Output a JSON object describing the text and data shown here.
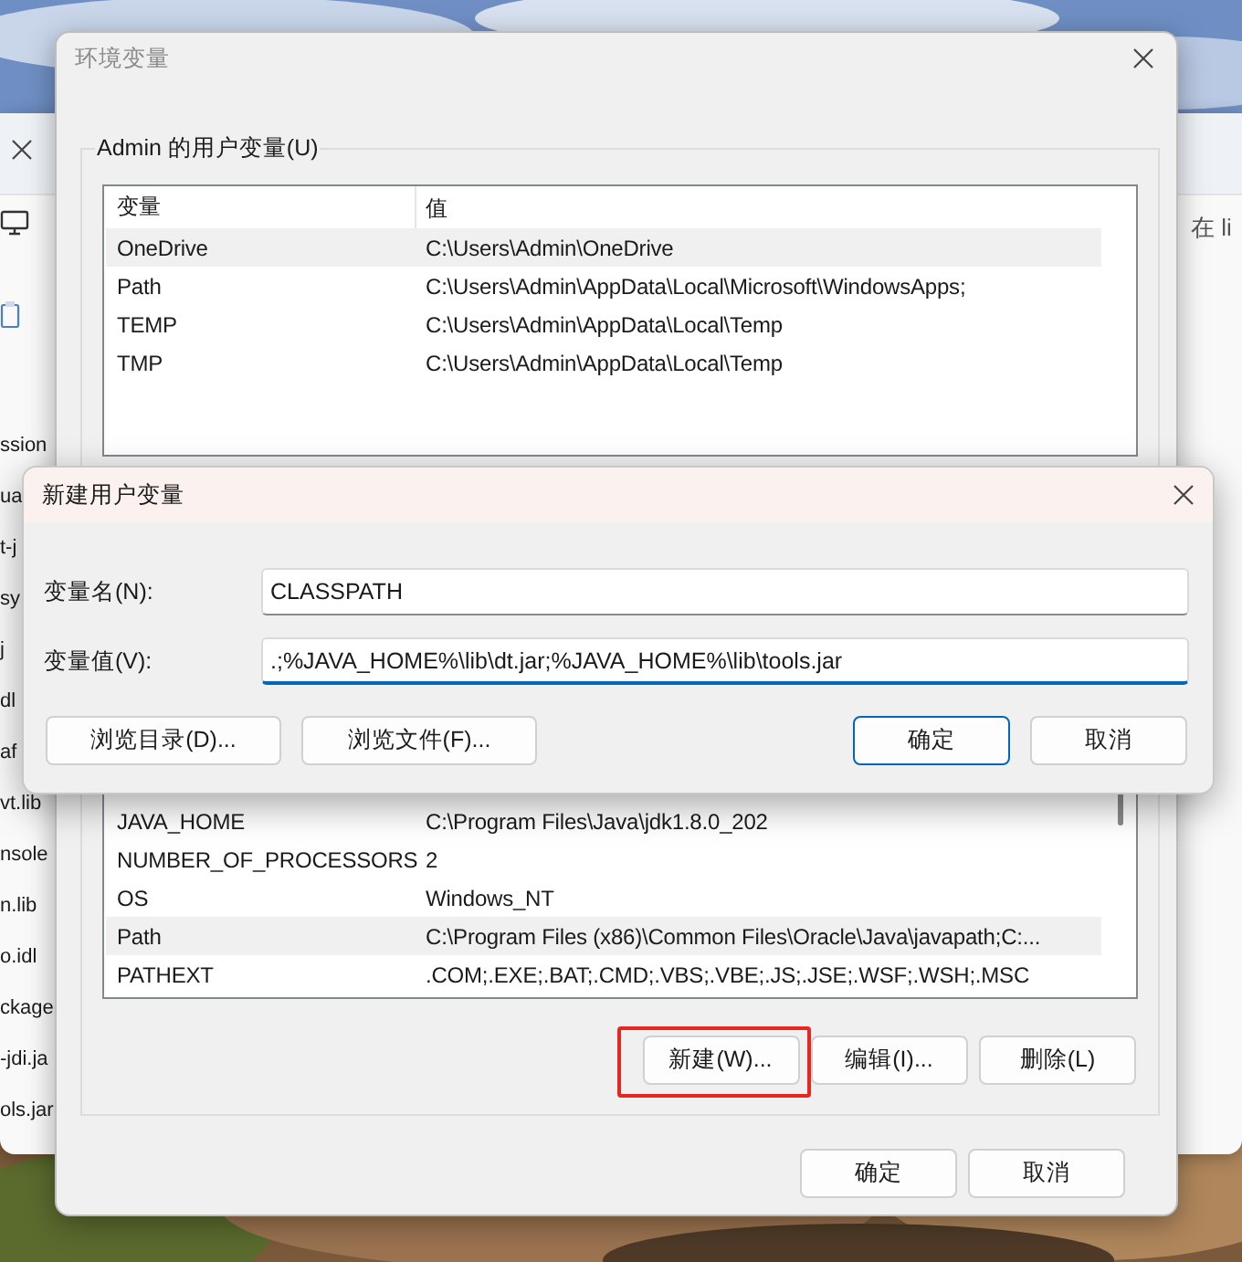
{
  "background_window": {
    "search_placeholder": "在 li",
    "file_names": [
      "ssion",
      "ua",
      "t-j",
      "sy",
      "j",
      "dl",
      "af",
      "vt.lib",
      "nsole",
      "n.lib",
      "o.idl",
      "ckage",
      "-jdi.ja",
      "ols.jar"
    ]
  },
  "parent_dialog": {
    "title": "环境变量",
    "active": false,
    "user_variables": {
      "label": "Admin 的用户变量(U)",
      "columns": [
        "变量",
        "值"
      ],
      "rows": [
        {
          "name": "OneDrive",
          "value": "C:\\Users\\Admin\\OneDrive",
          "selected": true
        },
        {
          "name": "Path",
          "value": "C:\\Users\\Admin\\AppData\\Local\\Microsoft\\WindowsApps;",
          "selected": false
        },
        {
          "name": "TEMP",
          "value": "C:\\Users\\Admin\\AppData\\Local\\Temp",
          "selected": false
        },
        {
          "name": "TMP",
          "value": "C:\\Users\\Admin\\AppData\\Local\\Temp",
          "selected": false
        }
      ]
    },
    "system_rows": [
      {
        "name": "JAVA_HOME",
        "value": "C:\\Program Files\\Java\\jdk1.8.0_202",
        "selected": false
      },
      {
        "name": "NUMBER_OF_PROCESSORS",
        "value": "2",
        "selected": false
      },
      {
        "name": "OS",
        "value": "Windows_NT",
        "selected": false
      },
      {
        "name": "Path",
        "value": "C:\\Program Files (x86)\\Common Files\\Oracle\\Java\\javapath;C:...",
        "selected": true
      },
      {
        "name": "PATHEXT",
        "value": ".COM;.EXE;.BAT;.CMD;.VBS;.VBE;.JS;.JSE;.WSF;.WSH;.MSC",
        "selected": false
      }
    ],
    "system_buttons": [
      {
        "label": "新建(W)...",
        "highlighted": true
      },
      {
        "label": "编辑(I)...",
        "highlighted": false
      },
      {
        "label": "删除(L)",
        "highlighted": false
      }
    ],
    "buttons": [
      {
        "label": "确定"
      },
      {
        "label": "取消"
      }
    ]
  },
  "dialog": {
    "title": "新建用户变量",
    "fields": [
      {
        "label": "变量名(N):",
        "value": "CLASSPATH",
        "focused": false
      },
      {
        "label": "变量值(V):",
        "value": ".;%JAVA_HOME%\\lib\\dt.jar;%JAVA_HOME%\\lib\\tools.jar",
        "focused": true
      }
    ],
    "buttons": [
      {
        "label": "浏览目录(D)...",
        "default": false
      },
      {
        "label": "浏览文件(F)...",
        "default": false
      },
      {
        "label": "确定",
        "default": true
      },
      {
        "label": "取消",
        "default": false
      }
    ]
  }
}
